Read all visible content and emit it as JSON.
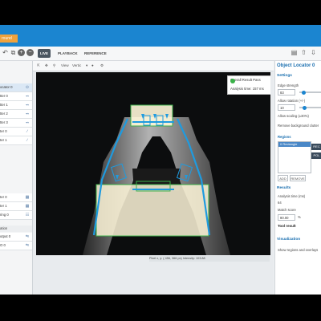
{
  "app": {
    "top_tag": "round"
  },
  "toolbar": {
    "tabs": [
      {
        "label": "LIVE",
        "active": true
      },
      {
        "label": "PLAYBACK",
        "active": false
      },
      {
        "label": "REFERENCE IMAGE",
        "active": false
      }
    ],
    "view_label": "View",
    "view_value": "Vertic"
  },
  "left_panel": {
    "items_top": [
      {
        "label": "ocator 0",
        "selected": true
      },
      {
        "label": "tter 0",
        "selected": false
      },
      {
        "label": "tter 1",
        "selected": false
      },
      {
        "label": "tter 2",
        "selected": false
      },
      {
        "label": "tter 3",
        "selected": false
      },
      {
        "label": "ter 0",
        "selected": false
      },
      {
        "label": "ter 1",
        "selected": false
      }
    ],
    "items_mid": [
      {
        "label": "ter 0"
      },
      {
        "label": "ter 1"
      },
      {
        "label": "ring 0"
      }
    ],
    "section": "ation",
    "items_bottom": [
      {
        "label": "utput 0"
      },
      {
        "label": "O 0"
      }
    ]
  },
  "viewer": {
    "result_title": "Overall Result Pass",
    "analysis_time": "Analysis time: 157 ms",
    "status_line": "Pixel x, y: ( 456, 366 px)  Intensity: 103.88"
  },
  "right_panel": {
    "title": "Object Locator 0",
    "settings_header": "Settings",
    "edge_strength_label": "Edge strength",
    "edge_strength_value": "83",
    "allow_rotation_label": "Allow rotation (+/-)",
    "allow_rotation_value": "10",
    "allow_scaling_label": "Allow scaling (±30%)",
    "remove_bg_label": "Remove background clutter",
    "regions_label": "Regions",
    "region_item": "0 Rectangle",
    "btn_rect": "REC",
    "btn_poly": "POL",
    "add_label": "ADD",
    "remove_label": "REMOVE",
    "results_header": "Results",
    "analysis_time_label": "Analysis time (ms)",
    "analysis_time_value": "64",
    "match_score_label": "Match score",
    "match_score_value": "80.00",
    "match_score_unit": "%",
    "tool_result": "Tool result",
    "visualization_header": "Visualization",
    "show_regions_label": "Show regions and overlays"
  },
  "colors": {
    "accent": "#1b85d0",
    "tag": "#f0a23c",
    "pass": "#3bb24a",
    "region": "#3cb04a",
    "edge": "#1e9be0"
  }
}
